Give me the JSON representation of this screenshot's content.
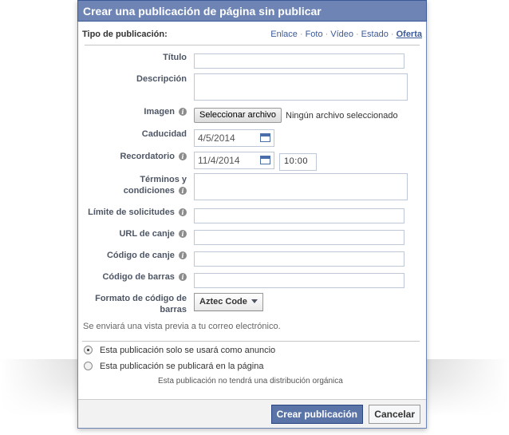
{
  "dialog": {
    "title": "Crear una publicación de página sin publicar"
  },
  "post_type": {
    "label": "Tipo de publicación:",
    "options": [
      "Enlace",
      "Foto",
      "Vídeo",
      "Estado",
      "Oferta"
    ],
    "selected": "Oferta"
  },
  "fields": {
    "title_label": "Título",
    "description_label": "Descripción",
    "image_label": "Imagen",
    "image_button": "Seleccionar archivo",
    "image_status": "Ningún archivo seleccionado",
    "expiration_label": "Caducidad",
    "expiration_value": "4/5/2014",
    "reminder_label": "Recordatorio",
    "reminder_date": "11/4/2014",
    "reminder_time": "10:00",
    "terms_label_line1": "Términos y",
    "terms_label_line2": "condiciones",
    "claim_limit_label": "Límite de solicitudes",
    "redeem_url_label": "URL de canje",
    "redeem_code_label": "Código de canje",
    "barcode_label": "Código de barras",
    "barcode_format_label_line1": "Formato de código de",
    "barcode_format_label_line2": "barras",
    "barcode_format_value": "Aztec Code"
  },
  "preview_note": "Se enviará una vista previa a tu correo electrónico.",
  "publish_options": {
    "ad_only": "Esta publicación solo se usará como anuncio",
    "publish_page": "Esta publicación se publicará en la página",
    "selected": "ad_only",
    "organic_note": "Esta publicación no tendrá una distribución orgánica"
  },
  "buttons": {
    "create": "Crear publicación",
    "cancel": "Cancelar"
  },
  "colors": {
    "title_bar": "#6d84b4",
    "link": "#3b5998",
    "primary_button": "#5b74a8"
  },
  "icons": {
    "info": "info-icon",
    "calendar": "calendar-icon",
    "dropdown": "chevron-down-icon"
  }
}
